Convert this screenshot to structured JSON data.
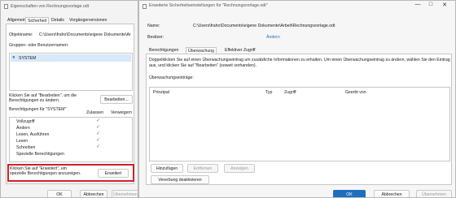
{
  "left": {
    "title": "Eigenschaften von Rechnungsvorlage.odt",
    "tabs": [
      "Allgemein",
      "Sicherheit",
      "Details",
      "Vorgängerversionen"
    ],
    "object_label": "Objektname:",
    "object_value": "C:\\Users\\fraho\\Documents\\eigene Dokumente\\Ar",
    "groups_label": "Gruppen- oder Benutzernamen:",
    "group_item": "SYSTEM",
    "edit_hint": "Klicken Sie auf \"Bearbeiten\", um die Berechtigungen zu ändern.",
    "edit_button": "Bearbeiten...",
    "perm_header": "Berechtigungen für \"SYSTEM\"",
    "allow_col": "Zulassen",
    "deny_col": "Verweigern",
    "permissions": [
      {
        "name": "Vollzugriff",
        "allow": true
      },
      {
        "name": "Ändern",
        "allow": true
      },
      {
        "name": "Lesen, Ausführen",
        "allow": true
      },
      {
        "name": "Lesen",
        "allow": true
      },
      {
        "name": "Schreiben",
        "allow": true
      },
      {
        "name": "Spezielle Berechtigungen",
        "allow": false
      }
    ],
    "advanced_hint": "Klicken Sie auf \"Erweitert\", um spezielle Berechtigungen anzuzeigen.",
    "advanced_button": "Erweitert",
    "ok": "OK",
    "cancel": "Abbrechen",
    "apply": "Übernehmen"
  },
  "right": {
    "title": "Erweiterte Sicherheitseinstellungen für \"Rechnungsvorlage.odt\"",
    "name_label": "Name:",
    "name_value": "C:\\Users\\fraho\\Documents\\eigene Dokumente\\Arbeit\\Rechnungsvorlage.odt",
    "owner_label": "Besitzer:",
    "owner_link": "Ändern",
    "tabs": [
      "Berechtigungen",
      "Überwachung",
      "Effektiver Zugriff"
    ],
    "description": "Doppelklicken Sie auf einen Überwachungseintrag um zusätzliche Informationen zu erhalten. Um einen Überwachungseintrag zu ändern, wählen Sie den Eintrag aus, und klicken Sie auf \"Bearbeiten\" (soweit vorhanden).",
    "entries_label": "Überwachungseinträge:",
    "columns": [
      "Prinzipal",
      "Typ",
      "Zugriff",
      "Geerbt von"
    ],
    "add_button": "Hinzufügen",
    "remove_button": "Entfernen",
    "view_button": "Anzeigen",
    "disable_inherit_button": "Vererbung deaktivieren",
    "ok": "OK",
    "cancel": "Abbrechen",
    "apply": "Übernehmen",
    "highlight_color": "#d1202a"
  }
}
